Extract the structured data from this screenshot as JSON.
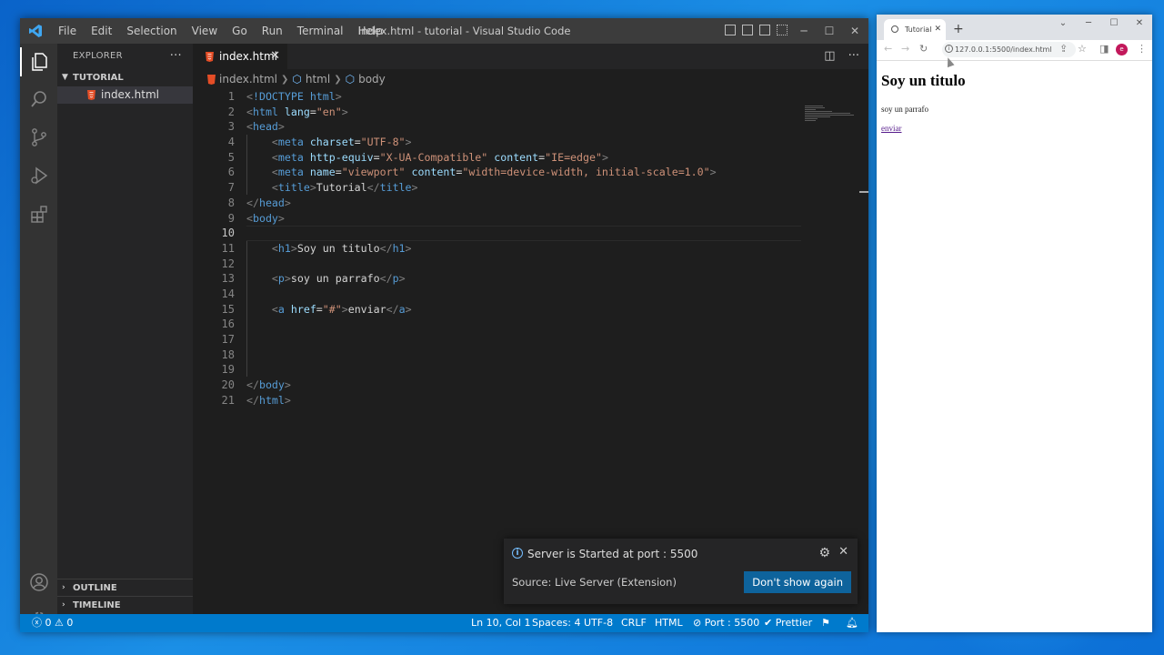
{
  "vscode": {
    "menu": [
      "File",
      "Edit",
      "Selection",
      "View",
      "Go",
      "Run",
      "Terminal",
      "Help"
    ],
    "window_title": "index.html - tutorial - Visual Studio Code",
    "sidebar": {
      "header": "EXPLORER",
      "folder": "TUTORIAL",
      "file": "index.html",
      "outline": "OUTLINE",
      "timeline": "TIMELINE"
    },
    "tab": {
      "label": "index.html"
    },
    "breadcrumb": [
      "index.html",
      "html",
      "body"
    ],
    "line_numbers": [
      "1",
      "2",
      "3",
      "4",
      "5",
      "6",
      "7",
      "8",
      "9",
      "10",
      "11",
      "12",
      "13",
      "14",
      "15",
      "16",
      "17",
      "18",
      "19",
      "20",
      "21"
    ],
    "code_lines": [
      "<!DOCTYPE html>",
      "<html lang=\"en\">",
      "<head>",
      "    <meta charset=\"UTF-8\">",
      "    <meta http-equiv=\"X-UA-Compatible\" content=\"IE=edge\">",
      "    <meta name=\"viewport\" content=\"width=device-width, initial-scale=1.0\">",
      "    <title>Tutorial</title>",
      "</head>",
      "<body>",
      "",
      "    <h1>Soy un titulo</h1>",
      "",
      "    <p>soy un parrafo</p>",
      "",
      "    <a href=\"#\">enviar</a>",
      "",
      "",
      "",
      "",
      "</body>",
      "</html>"
    ],
    "notification": {
      "message": "Server is Started at port : 5500",
      "source": "Source: Live Server (Extension)",
      "button": "Don't show again"
    },
    "statusbar": {
      "errors": "0",
      "warnings": "0",
      "position": "Ln 10, Col 1",
      "spaces": "Spaces: 4",
      "encoding": "UTF-8",
      "eol": "CRLF",
      "language": "HTML",
      "port": "Port : 5500",
      "prettier": "Prettier"
    },
    "colors": {
      "accent": "#007acc",
      "button": "#0e639c",
      "titlebar": "#3c3c3c"
    }
  },
  "browser": {
    "tab_title": "Tutorial",
    "url": "127.0.0.1:5500/index.html",
    "avatar_letter": "e",
    "page": {
      "heading": "Soy un titulo",
      "paragraph": "soy un parrafo",
      "link": "enviar"
    }
  }
}
